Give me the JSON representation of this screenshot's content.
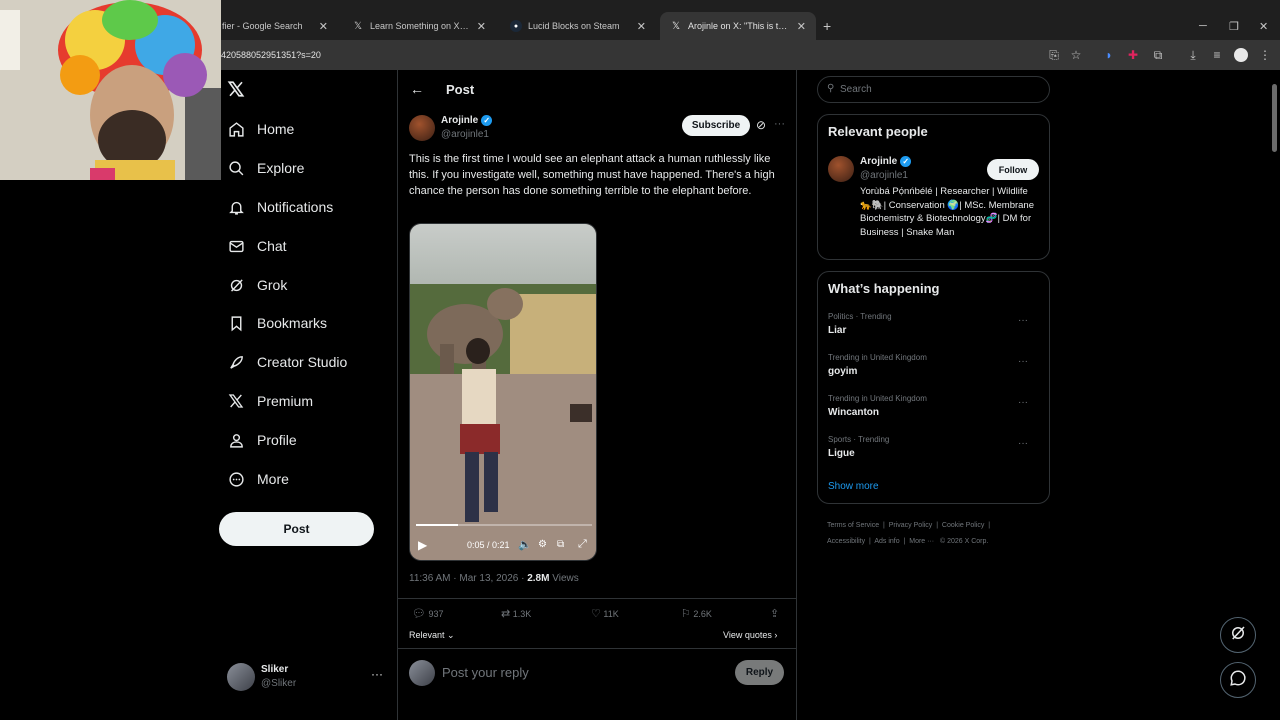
{
  "browser": {
    "tabs": [
      {
        "label": "fier - Google Search",
        "icon": "google-icon"
      },
      {
        "label": "Learn Something on X: \"An Indi",
        "icon": "x-logo-icon"
      },
      {
        "label": "Lucid Blocks on Steam",
        "icon": "steam-icon"
      },
      {
        "label": "Arojinle on X: \"This is the first ti",
        "icon": "x-logo-icon",
        "active": true
      }
    ],
    "new_tab": "+",
    "url": "420588052951351?s=20"
  },
  "nav": {
    "items": [
      {
        "label": "Home",
        "icon": "home-icon"
      },
      {
        "label": "Explore",
        "icon": "search-icon"
      },
      {
        "label": "Notifications",
        "icon": "bell-icon"
      },
      {
        "label": "Chat",
        "icon": "mail-icon"
      },
      {
        "label": "Grok",
        "icon": "grok-icon"
      },
      {
        "label": "Bookmarks",
        "icon": "bookmark-icon"
      },
      {
        "label": "Creator Studio",
        "icon": "rocket-icon"
      },
      {
        "label": "Premium",
        "icon": "x-logo-icon"
      },
      {
        "label": "Profile",
        "icon": "person-icon"
      },
      {
        "label": "More",
        "icon": "more-circle-icon"
      }
    ],
    "post_button": "Post",
    "account": {
      "name": "Sliker",
      "handle": "@Sliker"
    }
  },
  "post": {
    "header_title": "Post",
    "author": {
      "name": "Arojinle",
      "handle": "@arojinle1"
    },
    "subscribe": "Subscribe",
    "text": "This is the first time I would see an elephant attack a human ruthlessly like this. If you investigate well, something must have happened. There's a high chance the person has done something terrible to the elephant before.",
    "video": {
      "time": "0:05 / 0:21",
      "progress": 0.24
    },
    "meta": {
      "time": "11:36 AM · Mar 13, 2026 · ",
      "views_count": "2.8M",
      "views_label": " Views"
    },
    "stats": {
      "replies": "937",
      "reposts": "1.3K",
      "likes": "11K",
      "bookmarks": "2.6K"
    },
    "relevant": "Relevant",
    "view_quotes": "View quotes",
    "reply_placeholder": "Post your reply",
    "reply_button": "Reply"
  },
  "sidebar": {
    "search_placeholder": "Search",
    "relevant_people": {
      "title": "Relevant people",
      "name": "Arojinle",
      "handle": "@arojinle1",
      "follow": "Follow",
      "bio": "Yorùbá Pọ́nńbélé | Researcher | Wildlife 🐆🐘| Conservation 🌍| MSc. Membrane Biochemistry & Biotechnology🧬| DM for Business | Snake Man"
    },
    "happening": {
      "title": "What’s happening",
      "trends": [
        {
          "meta": "Politics · Trending",
          "name": "Liar"
        },
        {
          "meta": "Trending in United Kingdom",
          "name": "goyim"
        },
        {
          "meta": "Trending in United Kingdom",
          "name": "Wincanton"
        },
        {
          "meta": "Sports · Trending",
          "name": "Ligue"
        }
      ],
      "show_more": "Show more"
    },
    "footer": {
      "terms": "Terms of Service",
      "privacy": "Privacy Policy",
      "cookie": "Cookie Policy",
      "accessibility": "Accessibility",
      "ads": "Ads info",
      "more": "More ···",
      "copyright": "© 2026 X Corp."
    }
  },
  "colors": {
    "accent": "#1d9bf0",
    "background": "#000000",
    "border": "#2f3336",
    "muted": "#71767b"
  }
}
